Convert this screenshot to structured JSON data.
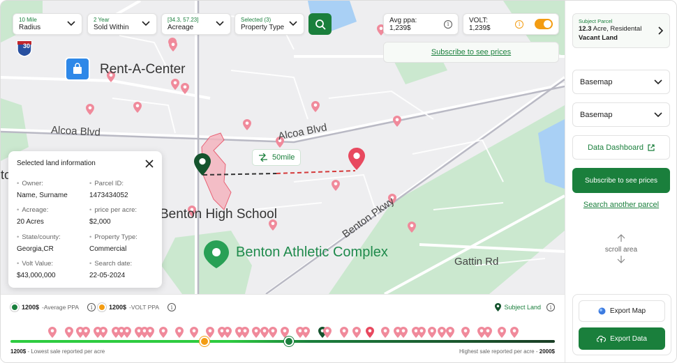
{
  "filters": [
    {
      "small": "10 Mile",
      "label": "Radius"
    },
    {
      "small": "2 Year",
      "label": "Sold Within"
    },
    {
      "small": "[34.3, 57.23]",
      "label": "Acreage"
    },
    {
      "small": "Selected (3)",
      "label": "Property Type"
    }
  ],
  "stats": {
    "avg_ppa": "Avg ppa: 1,239$",
    "volt": "VOLT: 1,239$",
    "volt_toggle": true
  },
  "subscribe_bar": "Subscribe to see prices",
  "map_labels": {
    "rent_a_center": "Rent-A-Center",
    "alcoa_blvd_1": "Alcoa Blvd",
    "alcoa_blvd_2": "Alcoa Blvd",
    "benton_high_school": "Benton High School",
    "benton_athletic_complex": "Benton Athletic Complex",
    "benton_pkwy": "Benton Pkwy",
    "gattin_rd": "Gattin Rd",
    "interstate": "30",
    "edge_text": "to"
  },
  "distance_badge": "50mile",
  "popup": {
    "title": "Selected land information",
    "fields": [
      {
        "key": "Owner:",
        "value": "Name, Surname"
      },
      {
        "key": "Parcel ID:",
        "value": "1473434052"
      },
      {
        "key": "Acreage:",
        "value": "20 Acres"
      },
      {
        "key": "price per acre:",
        "value": "$2,000"
      },
      {
        "key": "State/county:",
        "value": "Georgia,CR"
      },
      {
        "key": "Property Type:",
        "value": "Commercial"
      },
      {
        "key": "Volt Value:",
        "value": "$43,000,000"
      },
      {
        "key": "Search date:",
        "value": "22-05-2024"
      }
    ]
  },
  "bottom": {
    "avg_ppa_value": "1200$",
    "avg_ppa_label": "-Average PPA",
    "volt_ppa_value": "1200$",
    "volt_ppa_label": "-VOLT PPA",
    "subject_land": "Subject Land",
    "lowest_value": "1200$",
    "lowest_label": " - Lowest sale reported per acre",
    "highest_label": "Highest sale reported per acre - ",
    "highest_value": "2000$",
    "volt_marker_fraction": 0.357,
    "avg_marker_fraction": 0.512
  },
  "sidebar": {
    "subject_small": "Subject Parcel",
    "subject_acre_num": "12.3",
    "subject_acre_rest": " Acre, Residental",
    "subject_type": "Vacant Land",
    "basemap_1": "Basemap",
    "basemap_2": "Basemap",
    "data_dashboard": "Data Dashboard",
    "subscribe_btn": "Subscribe to see prices",
    "search_another": "Search another parcel",
    "scroll_area": "scroll area",
    "export_map": "Export Map",
    "export_data": "Export Data"
  },
  "colors": {
    "brand_green": "#1a7f3c",
    "volt_orange": "#f39c12",
    "pin_red": "#e8495f",
    "pin_pink": "#f08a9b"
  }
}
